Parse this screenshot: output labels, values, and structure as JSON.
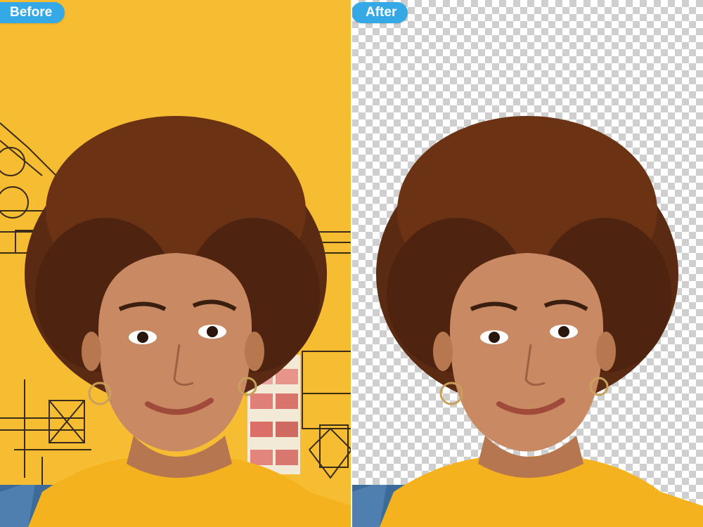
{
  "labels": {
    "before": "Before",
    "after": "After"
  },
  "colors": {
    "label_bg": "#35a8e6",
    "before_background": "#f6bd33",
    "checker_light": "#ffffff",
    "checker_dark": "#cfcfcf",
    "hair": "#5a2a12",
    "skin": "#c98a63",
    "sweater": "#f4b21f",
    "overalls": "#3d6b99"
  },
  "icons": {
    "hoop_earring": "earring-icon"
  }
}
